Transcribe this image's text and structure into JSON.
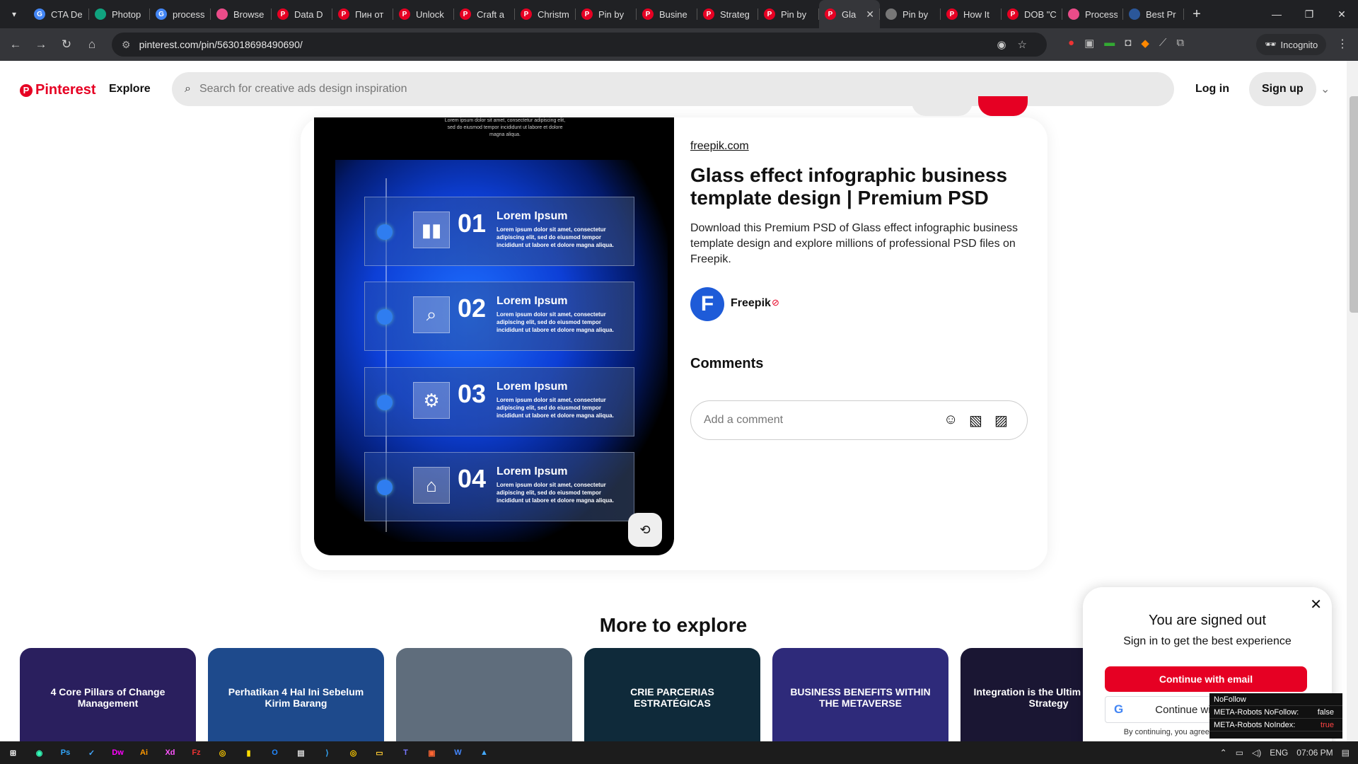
{
  "browser": {
    "tabs": [
      {
        "title": "CTA De",
        "icon": "google-icon",
        "color": "#4285f4"
      },
      {
        "title": "Photop",
        "icon": "chatgpt-icon",
        "color": "#10a37f"
      },
      {
        "title": "process",
        "icon": "google-icon",
        "color": "#4285f4"
      },
      {
        "title": "Browse",
        "icon": "dribbble-icon",
        "color": "#ea4c89"
      },
      {
        "title": "Data D",
        "icon": "pinterest-icon",
        "color": "#e60023"
      },
      {
        "title": "Пин от",
        "icon": "pinterest-icon",
        "color": "#e60023"
      },
      {
        "title": "Unlock",
        "icon": "pinterest-icon",
        "color": "#e60023"
      },
      {
        "title": "Craft a",
        "icon": "pinterest-icon",
        "color": "#e60023"
      },
      {
        "title": "Christm",
        "icon": "pinterest-icon",
        "color": "#e60023"
      },
      {
        "title": "Pin by",
        "icon": "pinterest-icon",
        "color": "#e60023"
      },
      {
        "title": "Busine",
        "icon": "pinterest-icon",
        "color": "#e60023"
      },
      {
        "title": "Strateg",
        "icon": "pinterest-icon",
        "color": "#e60023"
      },
      {
        "title": "Pin by",
        "icon": "pinterest-icon",
        "color": "#e60023"
      },
      {
        "title": "Gla",
        "icon": "pinterest-icon",
        "color": "#e60023",
        "active": true
      },
      {
        "title": "Pin by",
        "icon": "loading-icon",
        "color": "#777"
      },
      {
        "title": "How It",
        "icon": "pinterest-icon",
        "color": "#e60023"
      },
      {
        "title": "DOB \"C",
        "icon": "pinterest-icon",
        "color": "#e60023"
      },
      {
        "title": "Process",
        "icon": "dribbble-icon",
        "color": "#ea4c89"
      },
      {
        "title": "Best Pr",
        "icon": "word-icon",
        "color": "#2b579a"
      }
    ],
    "url": "pinterest.com/pin/563018698490690/",
    "incognito_label": "Incognito"
  },
  "header": {
    "logo": "Pinterest",
    "explore": "Explore",
    "search_placeholder": "Search for creative ads design inspiration",
    "login": "Log in",
    "signup": "Sign up"
  },
  "pin": {
    "image": {
      "top_text": "Lorem ipsum dolor sit amet, consectetur adipiscing elit, sed do eiusmod tempor incididunt ut labore et dolore magna aliqua.",
      "steps": [
        {
          "num": "01",
          "label": "Lorem Ipsum",
          "desc": "Lorem ipsum dolor sit amet, consectetur adipiscing elit, sed do eiusmod tempor incididunt ut labore et dolore magna aliqua.",
          "icon": "bar-chart-icon"
        },
        {
          "num": "02",
          "label": "Lorem Ipsum",
          "desc": "Lorem ipsum dolor sit amet, consectetur adipiscing elit, sed do eiusmod tempor incididunt ut labore et dolore magna aliqua.",
          "icon": "search-icon"
        },
        {
          "num": "03",
          "label": "Lorem Ipsum",
          "desc": "Lorem ipsum dolor sit amet, consectetur adipiscing elit, sed do eiusmod tempor incididunt ut labore et dolore magna aliqua.",
          "icon": "gear-icon"
        },
        {
          "num": "04",
          "label": "Lorem Ipsum",
          "desc": "Lorem ipsum dolor sit amet, consectetur adipiscing elit, sed do eiusmod tempor incididunt ut labore et dolore magna aliqua.",
          "icon": "home-icon"
        }
      ]
    },
    "source": "freepik.com",
    "title": "Glass effect infographic business template design | Premium PSD",
    "description": "Download this Premium PSD of Glass effect infographic business template design and explore millions of professional PSD files on Freepik.",
    "author_initial": "F",
    "author": "Freepik",
    "comments_heading": "Comments",
    "comment_placeholder": "Add a comment"
  },
  "more": {
    "heading": "More to explore",
    "thumbs": [
      {
        "text": "4 Core Pillars of Change Management",
        "color": "#2a1f5e"
      },
      {
        "text": "Perhatikan 4 Hal Ini Sebelum Kirim Barang",
        "color": "#1e4a8c"
      },
      {
        "text": "",
        "color": "#5f6d7c"
      },
      {
        "text": "CRIE PARCERIAS ESTRATÉGICAS",
        "color": "#0f2a3a"
      },
      {
        "text": "BUSINESS BENEFITS WITHIN THE METAVERSE",
        "color": "#2e2a7a"
      },
      {
        "text": "Integration is the Ultim MarTech Strategy",
        "color": "#1a1633"
      }
    ]
  },
  "popup": {
    "title": "You are signed out",
    "subtitle": "Sign in to get the best experience",
    "email_btn": "Continue with email",
    "google_btn": "Continue with Google",
    "terms": "By continuing, you agree to Pinterest's Terms of Service and acknowledge you've read our Privacy Policy. No"
  },
  "seo": {
    "title": "NoFollow",
    "row1_label": "META-Robots NoFollow:",
    "row1_value": "false",
    "row2_label": "META-Robots NoIndex:",
    "row2_value": "true"
  },
  "taskbar": {
    "lang": "ENG",
    "time": "07:06 PM"
  }
}
